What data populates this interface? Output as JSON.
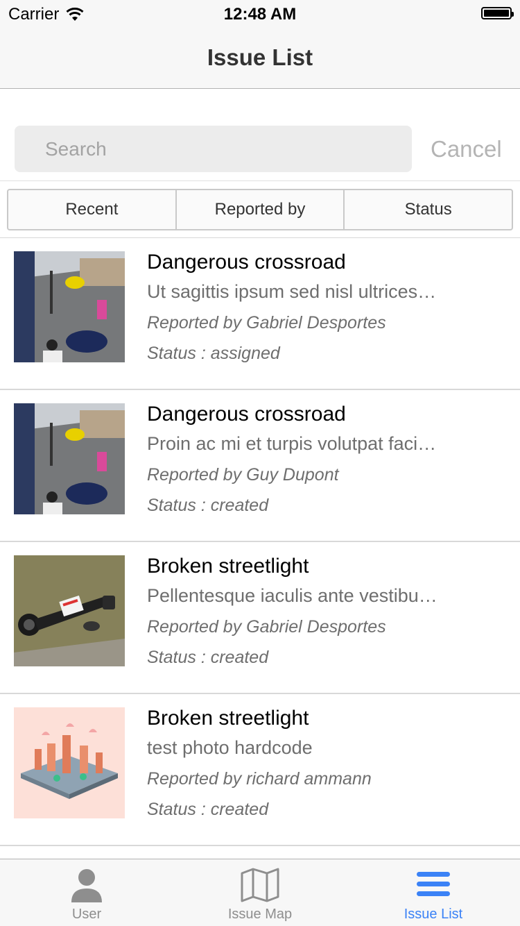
{
  "status_bar": {
    "carrier": "Carrier",
    "time": "12:48 AM"
  },
  "nav": {
    "title": "Issue List"
  },
  "search": {
    "placeholder": "Search",
    "value": "",
    "cancel_label": "Cancel"
  },
  "segments": [
    "Recent",
    "Reported by",
    "Status"
  ],
  "issues": [
    {
      "title": "Dangerous crossroad",
      "description": "Ut sagittis ipsum sed nisl ultrices…",
      "reporter": "Reported by Gabriel Desportes",
      "status": "Status : assigned",
      "thumb": "street-photo"
    },
    {
      "title": "Dangerous crossroad",
      "description": "Proin ac mi et turpis volutpat faci…",
      "reporter": "Reported by Guy Dupont",
      "status": "Status : created",
      "thumb": "street-photo"
    },
    {
      "title": "Broken streetlight",
      "description": "Pellentesque iaculis ante vestibu…",
      "reporter": "Reported by Gabriel Desportes",
      "status": "Status : created",
      "thumb": "fallen-lamp-photo"
    },
    {
      "title": "Broken streetlight",
      "description": "test photo hardcode",
      "reporter": "Reported by richard ammann",
      "status": "Status : created",
      "thumb": "isometric-city-illustration"
    }
  ],
  "tabs": [
    {
      "label": "User",
      "icon": "user-icon",
      "active": false
    },
    {
      "label": "Issue Map",
      "icon": "map-icon",
      "active": false
    },
    {
      "label": "Issue List",
      "icon": "list-icon",
      "active": true
    }
  ],
  "colors": {
    "accent": "#3b82f6",
    "inactive": "#8e8e8e",
    "bar_bg": "#f7f7f7"
  }
}
